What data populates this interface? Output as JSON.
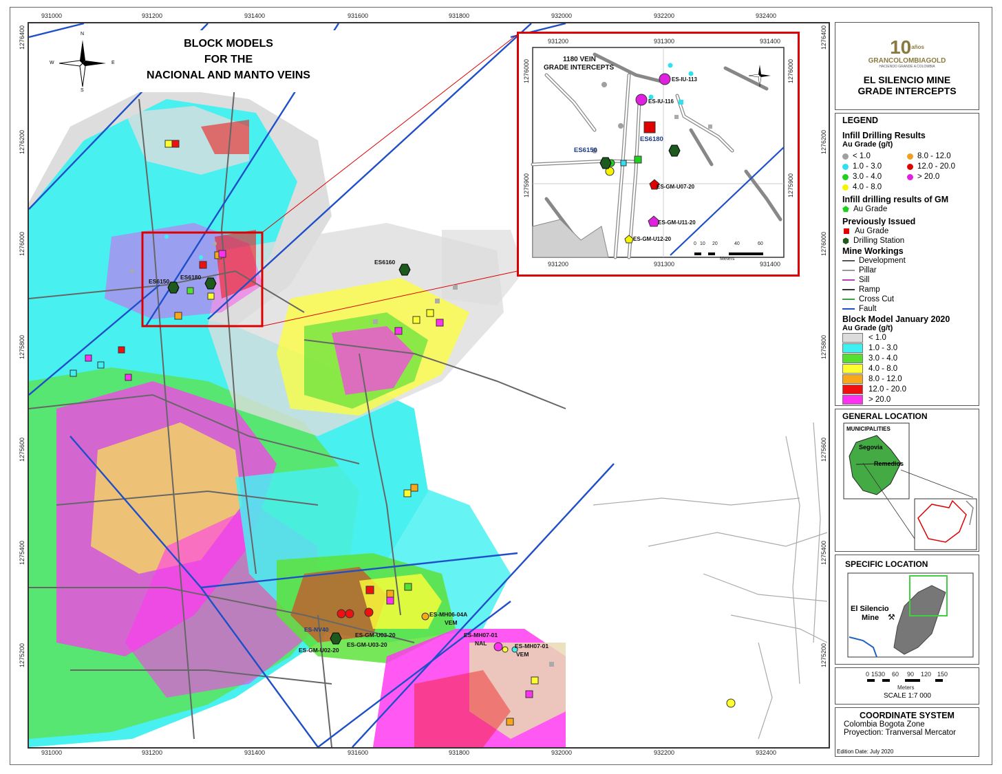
{
  "map": {
    "title_lines": [
      "BLOCK MODELS",
      "FOR THE",
      "NACIONAL AND MANTO VEINS"
    ],
    "x_ticks": [
      "931000",
      "931200",
      "931400",
      "931600",
      "931800",
      "932000",
      "932200",
      "932400"
    ],
    "y_ticks": [
      "1276400",
      "1276200",
      "1276000",
      "1275800",
      "1275600",
      "1275400",
      "1275200"
    ],
    "labels": {
      "es6150": "ES6150",
      "es6180": "ES6180",
      "es6160": "ES6160",
      "es_nv40": "ES-NV40",
      "gm_u03_a": "ES-GM-U03-20",
      "gm_u03_b": "ES-GM-U03-20",
      "gm_u02": "ES-GM-U02-20",
      "mh06": "ES-MH06-04A",
      "mh06_sub": "VEM",
      "mh07_nal": "ES-MH07-01",
      "mh07_nal_sub": "NAL",
      "mh07_vem": "ES-MH07-01",
      "mh07_vem_sub": "VEM"
    },
    "compass": {
      "n": "N",
      "s": "S",
      "e": "E",
      "w": "W"
    }
  },
  "inset": {
    "title": "1180 VEIN",
    "subtitle": "GRADE INTERCEPTS",
    "x_ticks": [
      "931200",
      "931300",
      "931400"
    ],
    "y_ticks": [
      "1276000",
      "1275900"
    ],
    "labels": {
      "iu113": "ES-IU-113",
      "iu116": "ES-IU-116",
      "es6180": "ES6180",
      "es6150": "ES6150",
      "u07": "ES-GM-U07-20",
      "u11": "ES-GM-U11-20",
      "u12": "ES-GM-U12-20"
    },
    "scale_ticks": [
      "0",
      "10",
      "20",
      "40",
      "60"
    ],
    "scale_unit": "Meters"
  },
  "header": {
    "logo_number": "10",
    "logo_years": "años",
    "logo_brand": "GRANCOLOMBIAGOLD",
    "logo_tagline": "HACIENDO GRANDE A COLOMBIA",
    "title_line1": "EL SILENCIO MINE",
    "title_line2": "GRADE INTERCEPTS"
  },
  "legend": {
    "heading": "LEGEND",
    "infill_heading": "Infill Drilling Results",
    "infill_sub": "Au Grade (g/t)",
    "infill_items": [
      {
        "label": "< 1.0",
        "color": "#a0a0a0"
      },
      {
        "label": "8.0 - 12.0",
        "color": "#f0a020"
      },
      {
        "label": "1.0 - 3.0",
        "color": "#30e0f0"
      },
      {
        "label": "12.0 - 20.0",
        "color": "#e00000"
      },
      {
        "label": "3.0 - 4.0",
        "color": "#20d020"
      },
      {
        "label": "> 20.0",
        "color": "#e020e0"
      },
      {
        "label": "4.0 - 8.0",
        "color": "#f5f500"
      }
    ],
    "gm_heading": "Infill drilling results of GM",
    "gm_item": "Au Grade",
    "prev_heading": "Previously Issued",
    "prev_items": [
      "Au Grade",
      "Drilling Station"
    ],
    "workings_heading": "Mine Workings",
    "workings_items": [
      {
        "label": "Development",
        "color": "#555555"
      },
      {
        "label": "Pillar",
        "color": "#999999"
      },
      {
        "label": "Sill",
        "color": "#b040b0"
      },
      {
        "label": "Ramp",
        "color": "#333333"
      },
      {
        "label": "Cross Cut",
        "color": "#40a040"
      },
      {
        "label": "Fault",
        "color": "#1f4fc8"
      }
    ],
    "block_heading": "Block Model January 2020",
    "block_sub": "Au Grade (g/t)",
    "block_items": [
      {
        "label": "< 1.0",
        "color": "#dcdcdc"
      },
      {
        "label": "1.0 - 3.0",
        "color": "#3ff0f0"
      },
      {
        "label": "3.0 - 4.0",
        "color": "#55e030"
      },
      {
        "label": "4.0 - 8.0",
        "color": "#ffff30"
      },
      {
        "label": "8.0 - 12.0",
        "color": "#f8a818"
      },
      {
        "label": "12.0 - 20.0",
        "color": "#f01010"
      },
      {
        "label": "> 20.0",
        "color": "#ff30f0"
      }
    ]
  },
  "general_location": {
    "title": "GENERAL LOCATION",
    "municipalities": "MUNICIPALITIES",
    "segovia": "Segovia",
    "remedios": "Remedios"
  },
  "specific_location": {
    "title": "SPECIFIC LOCATION",
    "mine_label_1": "El Silencio",
    "mine_label_2": "Mine"
  },
  "scale": {
    "ticks": [
      "0",
      "15",
      "30",
      "60",
      "90",
      "120",
      "150"
    ],
    "unit": "Meters",
    "label": "SCALE",
    "ratio": "1:7 000"
  },
  "coordinate_system": {
    "title": "COORDINATE SYSTEM",
    "line1": "Colombia Bogota Zone",
    "line2": "Proyection: Tranversal Mercator"
  },
  "edition": "Edition Date: July 2020"
}
